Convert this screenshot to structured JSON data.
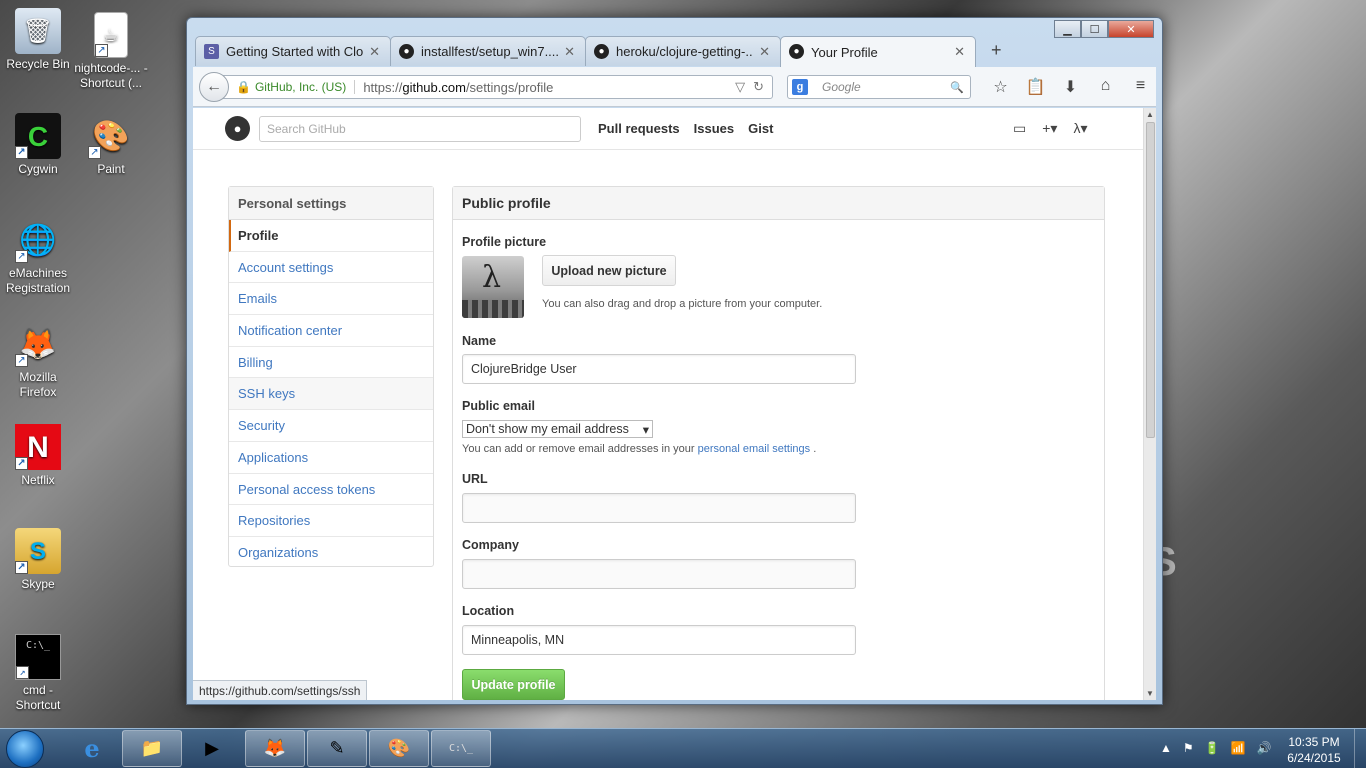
{
  "desktop": {
    "icons": [
      {
        "label": "Recycle Bin",
        "glyph": "🗑",
        "shortcut": false
      },
      {
        "label": "nightcode-... - Shortcut (...",
        "glyph": "☕",
        "shortcut": true
      },
      {
        "label": "Cygwin",
        "glyph": "C",
        "shortcut": true
      },
      {
        "label": "Paint",
        "glyph": "🎨",
        "shortcut": true
      },
      {
        "label": "eMachines Registration",
        "glyph": "🌐",
        "shortcut": true
      },
      {
        "label": "Mozilla Firefox",
        "glyph": "🦊",
        "shortcut": true
      },
      {
        "label": "Netflix",
        "glyph": "N",
        "shortcut": true
      },
      {
        "label": "Skype",
        "glyph": "S",
        "shortcut": true
      },
      {
        "label": "cmd - Shortcut",
        "glyph": "C:\\_",
        "shortcut": true
      }
    ]
  },
  "browser": {
    "window_controls": {
      "minimize": "▁",
      "maximize": "☐",
      "close": "✕"
    },
    "tabs": [
      {
        "label": "Getting Started with Clo...",
        "icon": "S",
        "close": "✕"
      },
      {
        "label": "installfest/setup_win7....",
        "icon": "●",
        "close": "✕"
      },
      {
        "label": "heroku/clojure-getting-...",
        "icon": "●",
        "close": "✕"
      },
      {
        "label": "Your Profile",
        "icon": "●",
        "close": "✕"
      }
    ],
    "new_tab": "+",
    "back": "←",
    "identity": "GitHub, Inc. (US)",
    "url_prefix": "https://",
    "url_host": "github.com",
    "url_path": "/settings/profile",
    "url_tools": [
      "▽",
      "↻"
    ],
    "search_engine": "g",
    "search_placeholder": "Google",
    "search_icon": "🔍",
    "toolbar_icons": [
      "☆",
      "📋",
      "⬇",
      "⌂",
      "≡"
    ],
    "status_text": "https://github.com/settings/ssh"
  },
  "github": {
    "logo": "●",
    "search_placeholder": "Search GitHub",
    "nav": [
      "Pull requests",
      "Issues",
      "Gist"
    ],
    "header_icons": [
      "▭",
      "+▾",
      "λ▾"
    ],
    "sidebar": {
      "title": "Personal settings",
      "items": [
        "Profile",
        "Account settings",
        "Emails",
        "Notification center",
        "Billing",
        "SSH keys",
        "Security",
        "Applications",
        "Personal access tokens",
        "Repositories",
        "Organizations"
      ]
    },
    "profile": {
      "title": "Public profile",
      "picture_label": "Profile picture",
      "avatar_glyph": "λ",
      "upload_button": "Upload new picture",
      "upload_note": "You can also drag and drop a picture from your computer.",
      "name_label": "Name",
      "name_value": "ClojureBridge User",
      "email_label": "Public email",
      "email_selected": "Don't show my email address",
      "email_caret": "▾",
      "email_note": "You can add or remove email addresses in your",
      "email_note_link": "personal email settings",
      "email_note_end": ".",
      "url_label": "URL",
      "url_value": "",
      "company_label": "Company",
      "company_value": "",
      "location_label": "Location",
      "location_value": "Minneapolis, MN",
      "update_button": "Update profile"
    }
  },
  "taskbar": {
    "apps": [
      "e",
      "📁",
      "▶",
      "🦊",
      "✎",
      "🎨",
      "C:\\_"
    ],
    "tray_icons": [
      "▲",
      "⚑",
      "🔋",
      "📶",
      "🔊"
    ],
    "time": "10:35 PM",
    "date": "6/24/2015"
  }
}
